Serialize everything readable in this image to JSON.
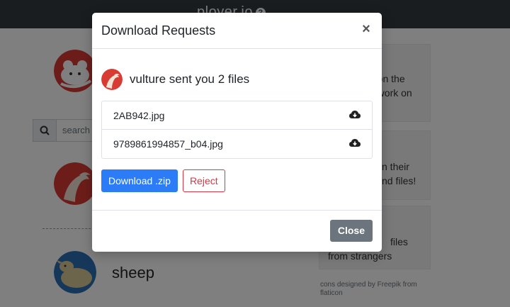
{
  "app": {
    "brand": "ployer.io",
    "help_icon": "question-circle-icon",
    "help_glyph": "?"
  },
  "background": {
    "search_placeholder": "search",
    "peer_name": "sheep",
    "info_cards": [
      {
        "line1": "e on the",
        "line2": "etwork on"
      },
      {
        "line1": "n their",
        "line2": "nd files!"
      },
      {
        "line1": "files",
        "line2": "from strangers"
      }
    ],
    "credit_line1": "cons designed by Freepik from",
    "credit_line2": "flaticon"
  },
  "modal": {
    "title": "Download Requests",
    "close_label": "×",
    "sender_message": "vulture sent you 2 files",
    "files": [
      {
        "name": "2AB942.jpg",
        "icon": "cloud-download-icon"
      },
      {
        "name": "9789861994857_b04.jpg",
        "icon": "cloud-download-icon"
      }
    ],
    "download_zip_label": "Download .zip",
    "reject_label": "Reject",
    "close_button_label": "Close"
  },
  "colors": {
    "topbar": "#343a40",
    "primary": "#2b7cf6",
    "danger": "#dc3545",
    "secondary": "#6c757d",
    "vulture_red": "#d83a34",
    "sheep_blue": "#2a6fb5"
  }
}
